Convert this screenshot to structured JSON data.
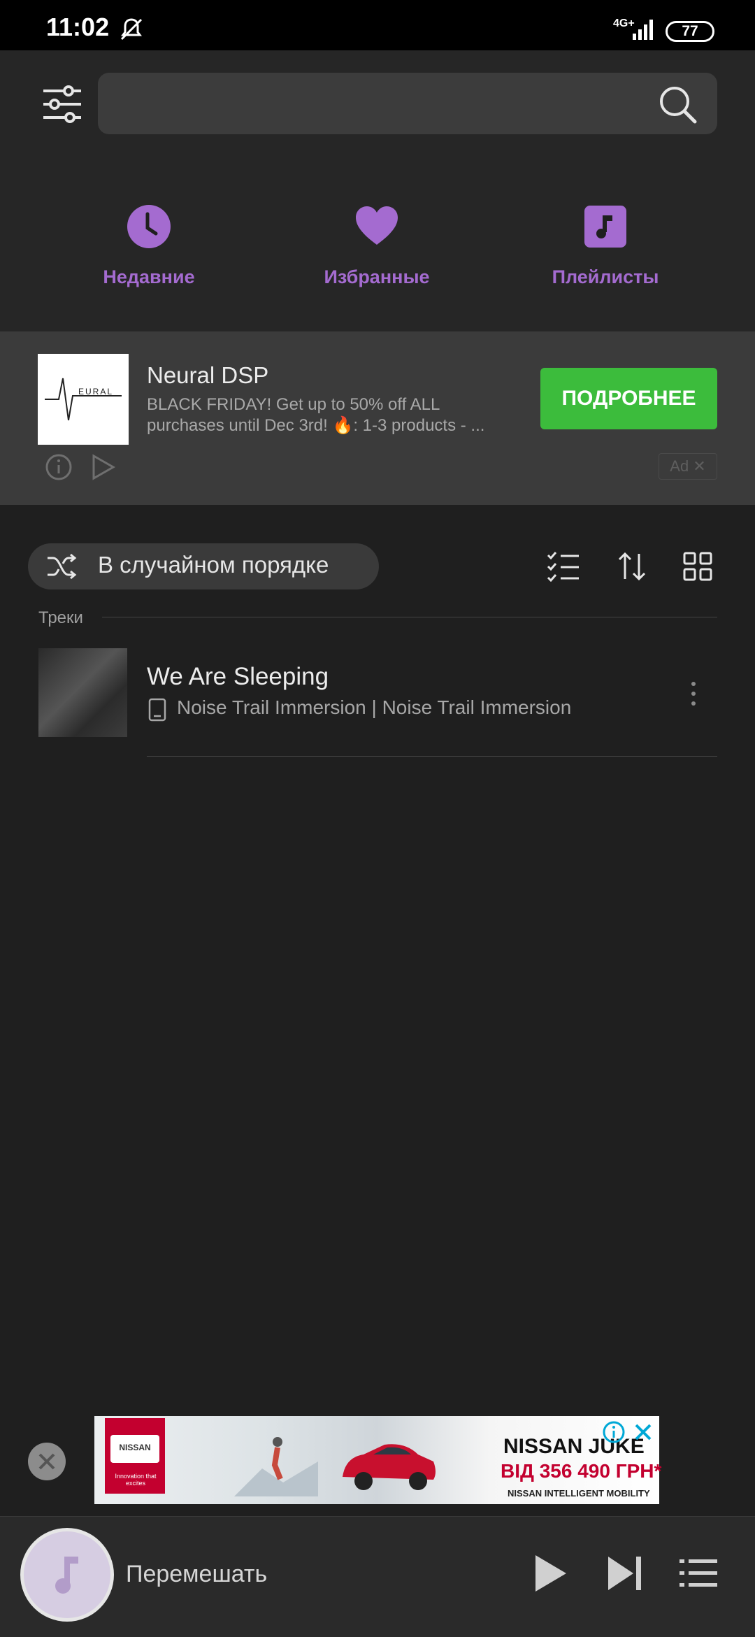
{
  "status_bar": {
    "time": "11:02",
    "network": "4G+",
    "battery": "77"
  },
  "quick_access": [
    {
      "label": "Недавние",
      "icon": "clock-icon"
    },
    {
      "label": "Избранные",
      "icon": "heart-icon"
    },
    {
      "label": "Плейлисты",
      "icon": "music-note-icon"
    }
  ],
  "ad": {
    "advertiser": "Neural DSP",
    "logo_text": "EURAL",
    "description": "BLACK FRIDAY!   Get up to 50% off ALL purchases until Dec 3rd!  🔥: 1-3 products - ...",
    "cta": "ПОДРОБНЕЕ",
    "tag": "Ad ✕"
  },
  "controls": {
    "shuffle_label": "В случайном порядке"
  },
  "tracks": {
    "header": "Треки",
    "items": [
      {
        "title": "We Are Sleeping",
        "subtitle": "Noise Trail Immersion | Noise Trail Immersion"
      }
    ]
  },
  "banner": {
    "brand_badge": "NISSAN",
    "brand_tagline": "Innovation that excites",
    "title": "NISSAN JUKE",
    "price": "ВІД 356 490 ГРН*",
    "footer": "NISSAN INTELLIGENT MOBILITY"
  },
  "player": {
    "label": "Перемешать"
  },
  "colors": {
    "accent": "#a46bd0",
    "cta": "#3cbc3c",
    "background": "#1f1f1f"
  }
}
